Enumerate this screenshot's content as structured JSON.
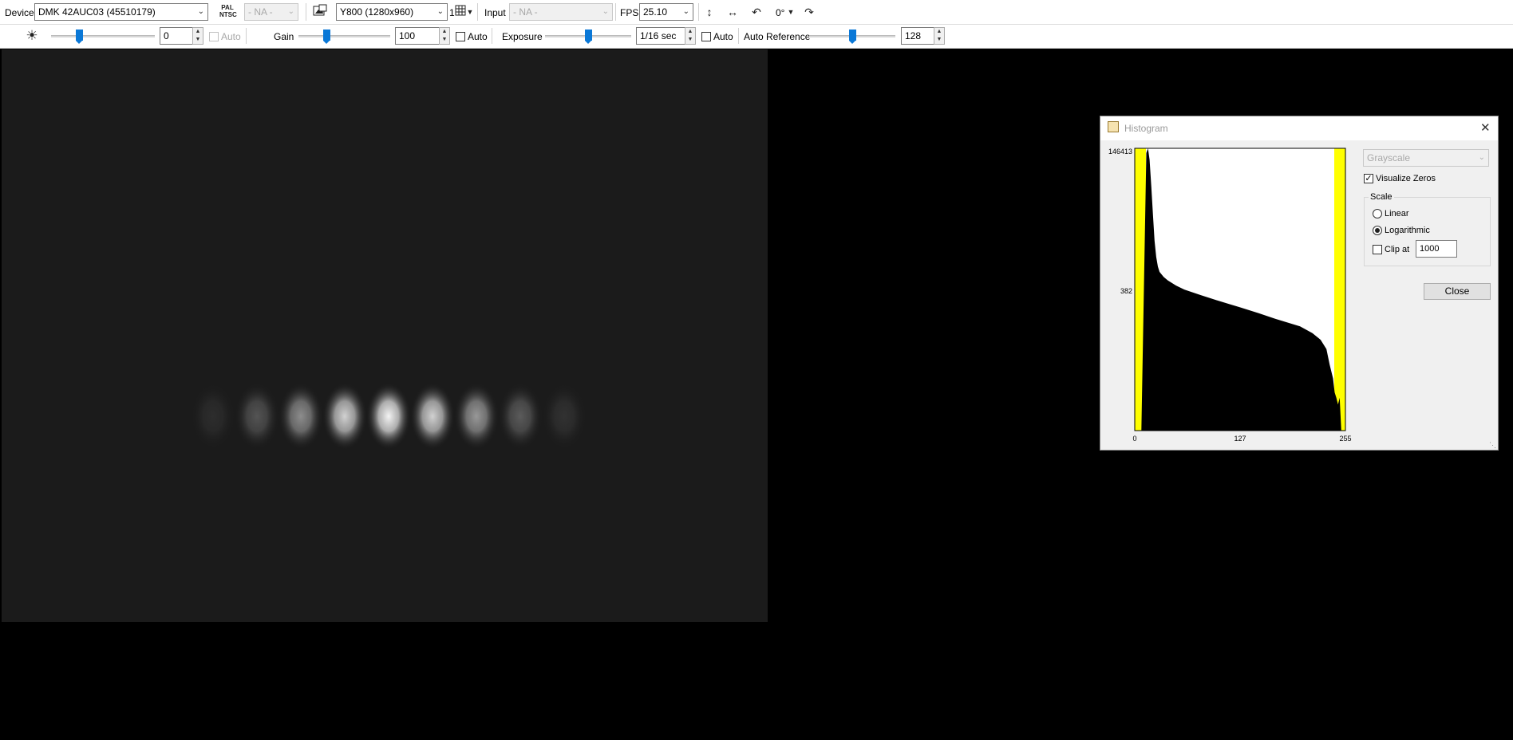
{
  "toolbar1": {
    "device_label": "Device",
    "device_value": "DMK 42AUC03 (45510179)",
    "pal_ntsc_icon": "PAL\nNTSC",
    "videonorm_value": "- NA -",
    "format_value": "Y800 (1280x960)",
    "binning_value": "1",
    "input_label": "Input",
    "input_value": "- NA -",
    "fps_label": "FPS",
    "fps_value": "25.10",
    "rotation_value": "0°"
  },
  "toolbar2": {
    "brightness_value": "0",
    "brightness_level": 0.27,
    "brightness_auto_label": "Auto",
    "gain_label": "Gain",
    "gain_value": "100",
    "gain_level": 0.3,
    "gain_auto_label": "Auto",
    "exposure_label": "Exposure",
    "exposure_value": "1/16 sec",
    "exposure_level": 0.5,
    "exposure_auto_label": "Auto",
    "autoref_label": "Auto Reference",
    "autoref_value": "128",
    "autoref_level": 0.5
  },
  "icons": {
    "brightness": "sun-icon",
    "pal_ntsc": "pal-ntsc-icon",
    "snapshot": "snapshot-icon",
    "grid": "grid-icon",
    "flip_vertical": "flip-vertical-icon",
    "flip_horizontal": "flip-horizontal-icon",
    "rotate_left": "rotate-left-icon",
    "rotate_right": "rotate-right-icon"
  },
  "histogram": {
    "title": "Histogram",
    "mode_value": "Grayscale",
    "visualize_zeros_label": "Visualize Zeros",
    "visualize_zeros_checked": true,
    "scale_label": "Scale",
    "linear_label": "Linear",
    "logarithmic_label": "Logarithmic",
    "scale_selected": "Logarithmic",
    "clip_label": "Clip at",
    "clip_value": "1000",
    "clip_checked": false,
    "close_label": "Close",
    "y_max_label": "146413",
    "y_mid_label": "382",
    "x_min_label": "0",
    "x_mid_label": "127",
    "x_max_label": "255",
    "clip_marker_color": "#ffff00"
  },
  "chart_data": {
    "type": "bar",
    "title": "",
    "xlabel": "",
    "ylabel": "",
    "x_range": [
      0,
      255
    ],
    "y_ticks": [
      382,
      146413
    ],
    "y_scale": "log",
    "x_ticks": [
      0,
      127,
      255
    ],
    "bins": [
      0,
      8,
      14,
      16,
      18,
      20,
      22,
      24,
      26,
      28,
      30,
      35,
      40,
      50,
      60,
      80,
      100,
      127,
      150,
      170,
      200,
      215,
      225,
      232,
      236,
      240,
      242,
      244,
      246,
      248,
      250,
      255
    ],
    "counts": [
      0,
      0,
      120000,
      146413,
      90000,
      30000,
      9000,
      3000,
      1500,
      1000,
      800,
      650,
      560,
      450,
      380,
      300,
      240,
      180,
      140,
      110,
      80,
      60,
      45,
      30,
      15,
      8,
      4,
      3,
      2,
      3,
      0,
      0
    ]
  },
  "video_frame": {
    "fringe_count": 9,
    "fringe_peaks": [
      0.08,
      0.25,
      0.5,
      0.8,
      0.95,
      0.8,
      0.55,
      0.28,
      0.1
    ]
  }
}
